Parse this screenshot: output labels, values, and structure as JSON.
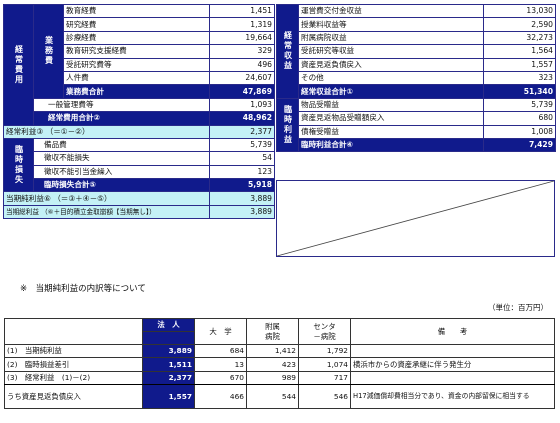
{
  "left": {
    "group_label": "経常費用",
    "sub_label": "業務費",
    "business_items": [
      {
        "label": "教育経費",
        "value": "1,451"
      },
      {
        "label": "研究経費",
        "value": "1,319"
      },
      {
        "label": "診療経費",
        "value": "19,664"
      },
      {
        "label": "教育研究支援経費",
        "value": "329"
      },
      {
        "label": "受託研究費等",
        "value": "496"
      },
      {
        "label": "人件費",
        "value": "24,607"
      }
    ],
    "business_total": {
      "label": "業務費合計",
      "value": "47,869"
    },
    "general_admin": {
      "label": "一般管理費等",
      "value": "1,093"
    },
    "ordinary_expense_total": {
      "label": "経常費用合計②",
      "value": "48,962"
    },
    "ordinary_profit": {
      "label": "経常利益③ （＝①－②）",
      "value": "2,377"
    },
    "extra_loss_label": "臨時損失",
    "extra_loss_items": [
      {
        "label": "備品費",
        "value": "5,739"
      },
      {
        "label": "徴収不能損失",
        "value": "54"
      },
      {
        "label": "徴収不能引当金繰入",
        "value": "123"
      }
    ],
    "extra_loss_total": {
      "label": "臨時損失合計⑤",
      "value": "5,918"
    },
    "net_profit": {
      "label": "当期純利益⑥ （＝③＋④－⑤）",
      "value": "3,889"
    },
    "total_profit": {
      "label": "当期総利益 （⑥＋目的積立金取崩額【当期無し】）",
      "value": "3,889"
    }
  },
  "right": {
    "revenue_label": "経常収益",
    "revenue_items": [
      {
        "label": "運営費交付金収益",
        "value": "13,030"
      },
      {
        "label": "授業料収益等",
        "value": "2,590"
      },
      {
        "label": "附属病院収益",
        "value": "32,273"
      },
      {
        "label": "受託研究等収益",
        "value": "1,564"
      },
      {
        "label": "資産見返負債戻入",
        "value": "1,557"
      },
      {
        "label": "その他",
        "value": "323"
      }
    ],
    "revenue_total": {
      "label": "経常収益合計①",
      "value": "51,340"
    },
    "extra_profit_label": "臨時利益",
    "extra_profit_items": [
      {
        "label": "物品受贈益",
        "value": "5,739"
      },
      {
        "label": "資産見返物品受贈額戻入",
        "value": "680"
      },
      {
        "label": "債権受贈益",
        "value": "1,008"
      }
    ],
    "extra_profit_total": {
      "label": "臨時利益合計④",
      "value": "7,429"
    }
  },
  "note": "※　当期純利益の内訳等について",
  "unit": "（単位：百万円）",
  "bottom": {
    "headers": [
      "法　人",
      "大　学",
      "附属\n病院",
      "センタ\n－病院",
      "備　　考"
    ],
    "rows": [
      {
        "label": "(1)　当期純利益",
        "corp": "3,889",
        "univ": "684",
        "hosp": "1,412",
        "center": "1,792",
        "note": ""
      },
      {
        "label": "(2)　臨時損益差引",
        "corp": "1,511",
        "univ": "13",
        "hosp": "423",
        "center": "1,074",
        "note": "横浜市からの資産承継に伴う発生分"
      },
      {
        "label": "(3)　経常利益　(1)－(2)",
        "corp": "2,377",
        "univ": "670",
        "hosp": "989",
        "center": "717",
        "note": ""
      },
      {
        "label": "うち資産見返負債戻入",
        "corp": "1,557",
        "univ": "466",
        "hosp": "544",
        "center": "546",
        "note": "H17減価償却費相当分であり、資金の内部留保に相当する"
      }
    ]
  },
  "colors": {
    "navy": "#101a8c",
    "cyan": "#c4f1f6",
    "border": "#2a2a8a"
  }
}
